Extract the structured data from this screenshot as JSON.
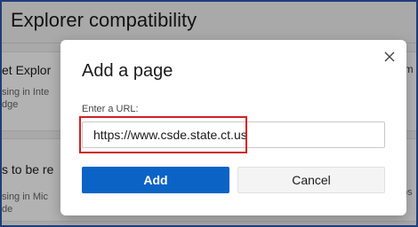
{
  "background": {
    "page_title": "Explorer compatibility",
    "section1": {
      "heading_fragment": "et Explor",
      "desc_line1": "sing in Inte",
      "desc_line2": "dge",
      "right_fragment": "om"
    },
    "section2": {
      "heading_fragment": "s to be re",
      "desc_line1": "sing in Mic",
      "desc_line2": "de",
      "right_fragment": "os"
    }
  },
  "dialog": {
    "title": "Add a page",
    "close_icon": "close-icon",
    "url_label": "Enter a URL:",
    "url_value": "https://www.csde.state.ct.us",
    "add_label": "Add",
    "cancel_label": "Cancel"
  },
  "colors": {
    "primary": "#0b63c6",
    "highlight": "#d11f24",
    "frame_border": "#1f3d7a"
  }
}
